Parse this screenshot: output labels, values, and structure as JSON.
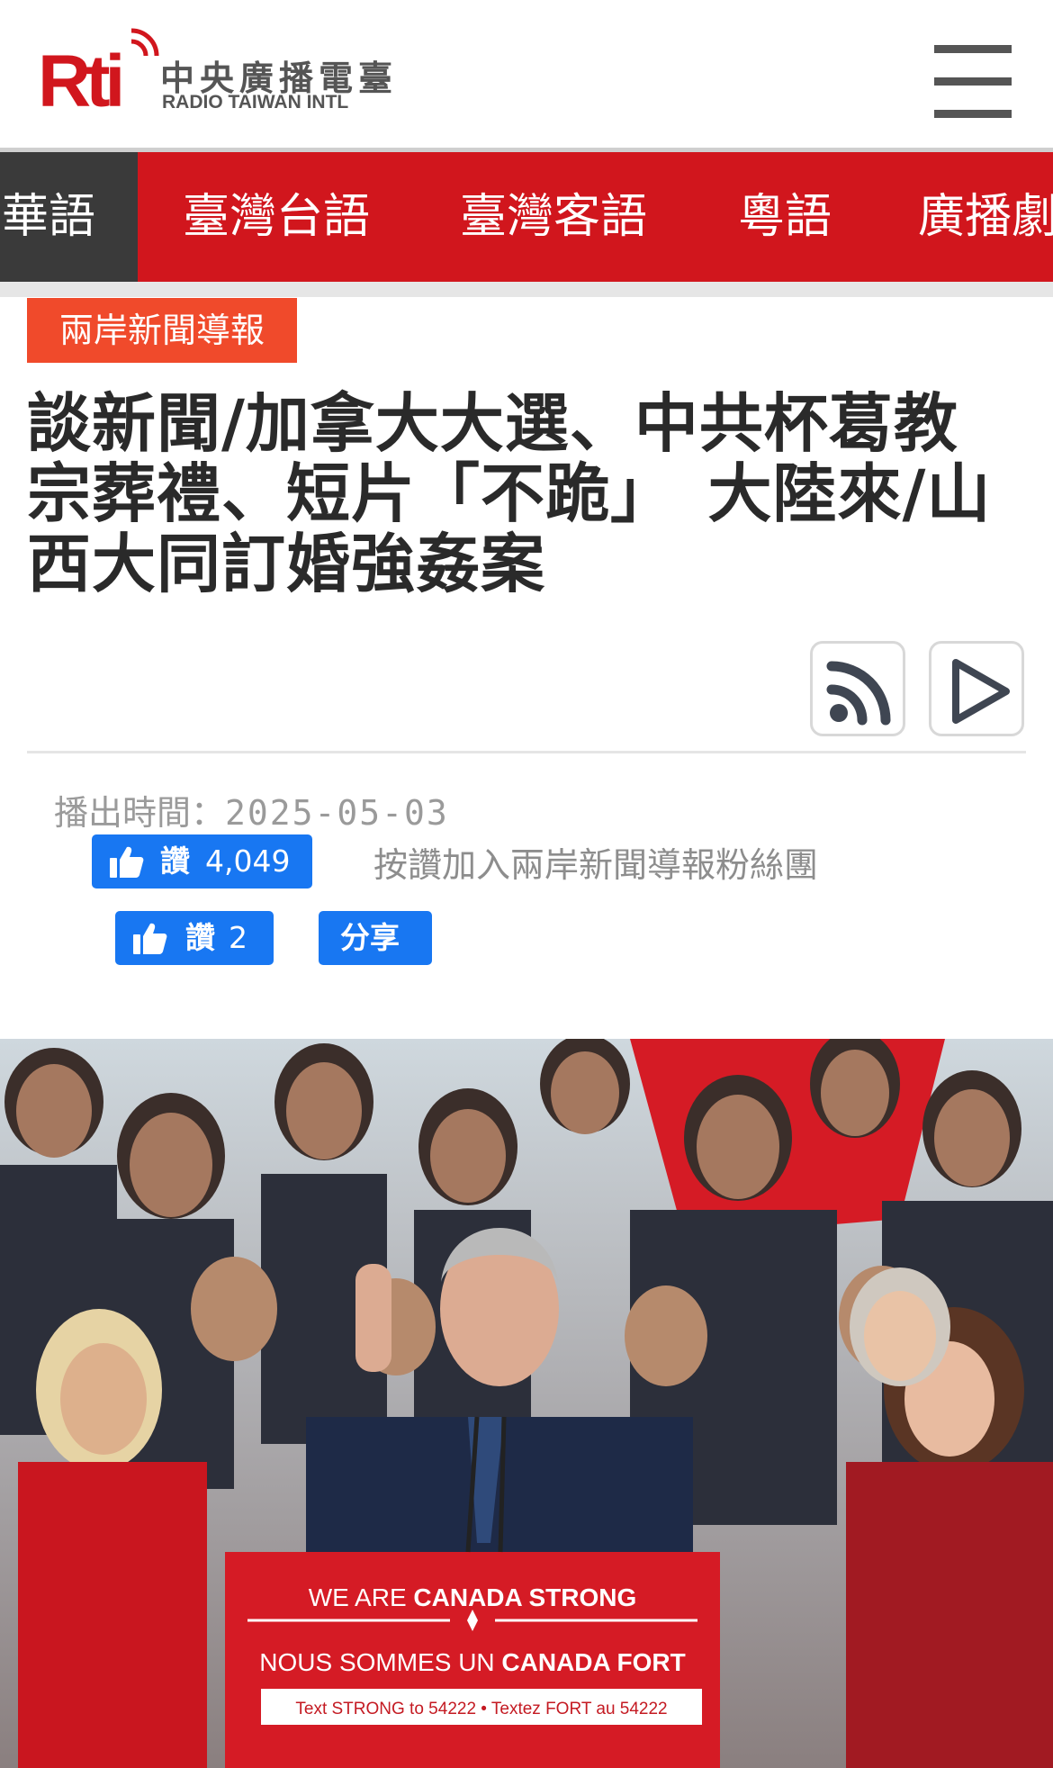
{
  "header": {
    "logo_mark": "Rti",
    "logo_zh": "中央廣播電臺",
    "logo_en": "RADIO TAIWAN INTL",
    "menu_icon": "hamburger-icon"
  },
  "lang_nav": {
    "items": [
      {
        "label": "華語",
        "active": true
      },
      {
        "label": "臺灣台語",
        "active": false
      },
      {
        "label": "臺灣客語",
        "active": false
      },
      {
        "label": "粵語",
        "active": false
      },
      {
        "label": "廣播劇",
        "active": false
      }
    ]
  },
  "article": {
    "category": "兩岸新聞導報",
    "title_lines": [
      "談新聞/加拿大大選、中共杯葛教",
      "宗葬禮、短片「不跪」　大陸來/山",
      "西大同訂婚強姦案"
    ],
    "rss_icon": "rss-icon",
    "play_icon": "play-icon",
    "broadcast_label": "播出時間：",
    "broadcast_date": "2025-05-03"
  },
  "social": {
    "page_like_label": "讚",
    "page_like_count": "4,049",
    "page_like_hint": "按讚加入兩岸新聞導報粉絲團",
    "article_like_label": "讚",
    "article_like_count": "2",
    "share_label": "分享"
  },
  "photo": {
    "sign_line1_a": "WE ARE ",
    "sign_line1_b": "CANADA STRONG",
    "sign_line2_a": "NOUS SOMMES UN ",
    "sign_line2_b": "CANADA FORT",
    "sign_line3": "Text STRONG to 54222 • Textez FORT au 54222",
    "brand_red": "#d1161d"
  }
}
